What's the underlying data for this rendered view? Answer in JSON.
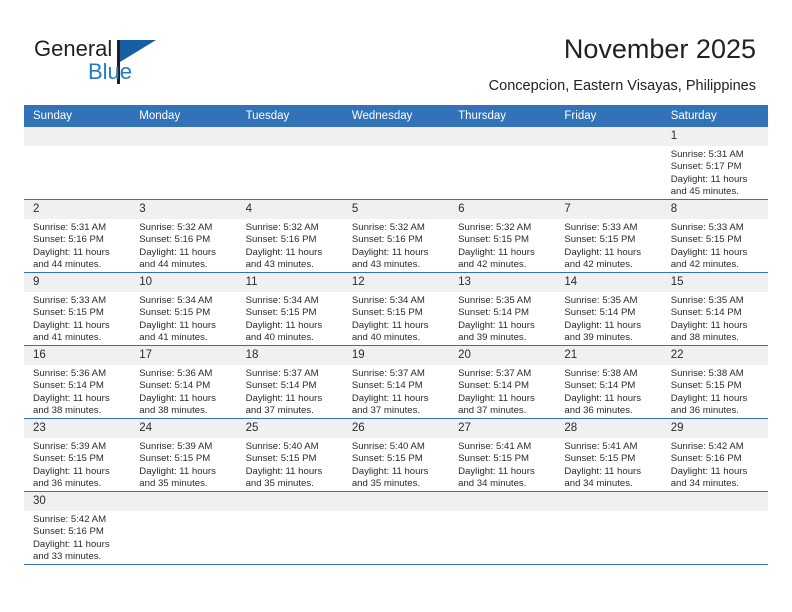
{
  "brand": {
    "name_part1": "General",
    "name_part2": "Blue",
    "logo_icon": "triangle-flag-icon",
    "accent_color": "#1f7ec4",
    "dark_color": "#231f20"
  },
  "header": {
    "title": "November 2025",
    "location": "Concepcion, Eastern Visayas, Philippines"
  },
  "calendar": {
    "header_bg": "#3172b9",
    "daynum_bg": "#f0f0f0",
    "weekdays": [
      "Sunday",
      "Monday",
      "Tuesday",
      "Wednesday",
      "Thursday",
      "Friday",
      "Saturday"
    ],
    "weeks": [
      [
        {
          "blank": true
        },
        {
          "blank": true
        },
        {
          "blank": true
        },
        {
          "blank": true
        },
        {
          "blank": true
        },
        {
          "blank": true
        },
        {
          "day": "1",
          "sunrise": "Sunrise: 5:31 AM",
          "sunset": "Sunset: 5:17 PM",
          "daylight_line1": "Daylight: 11 hours",
          "daylight_line2": "and 45 minutes."
        }
      ],
      [
        {
          "day": "2",
          "sunrise": "Sunrise: 5:31 AM",
          "sunset": "Sunset: 5:16 PM",
          "daylight_line1": "Daylight: 11 hours",
          "daylight_line2": "and 44 minutes."
        },
        {
          "day": "3",
          "sunrise": "Sunrise: 5:32 AM",
          "sunset": "Sunset: 5:16 PM",
          "daylight_line1": "Daylight: 11 hours",
          "daylight_line2": "and 44 minutes."
        },
        {
          "day": "4",
          "sunrise": "Sunrise: 5:32 AM",
          "sunset": "Sunset: 5:16 PM",
          "daylight_line1": "Daylight: 11 hours",
          "daylight_line2": "and 43 minutes."
        },
        {
          "day": "5",
          "sunrise": "Sunrise: 5:32 AM",
          "sunset": "Sunset: 5:16 PM",
          "daylight_line1": "Daylight: 11 hours",
          "daylight_line2": "and 43 minutes."
        },
        {
          "day": "6",
          "sunrise": "Sunrise: 5:32 AM",
          "sunset": "Sunset: 5:15 PM",
          "daylight_line1": "Daylight: 11 hours",
          "daylight_line2": "and 42 minutes."
        },
        {
          "day": "7",
          "sunrise": "Sunrise: 5:33 AM",
          "sunset": "Sunset: 5:15 PM",
          "daylight_line1": "Daylight: 11 hours",
          "daylight_line2": "and 42 minutes."
        },
        {
          "day": "8",
          "sunrise": "Sunrise: 5:33 AM",
          "sunset": "Sunset: 5:15 PM",
          "daylight_line1": "Daylight: 11 hours",
          "daylight_line2": "and 42 minutes."
        }
      ],
      [
        {
          "day": "9",
          "sunrise": "Sunrise: 5:33 AM",
          "sunset": "Sunset: 5:15 PM",
          "daylight_line1": "Daylight: 11 hours",
          "daylight_line2": "and 41 minutes."
        },
        {
          "day": "10",
          "sunrise": "Sunrise: 5:34 AM",
          "sunset": "Sunset: 5:15 PM",
          "daylight_line1": "Daylight: 11 hours",
          "daylight_line2": "and 41 minutes."
        },
        {
          "day": "11",
          "sunrise": "Sunrise: 5:34 AM",
          "sunset": "Sunset: 5:15 PM",
          "daylight_line1": "Daylight: 11 hours",
          "daylight_line2": "and 40 minutes."
        },
        {
          "day": "12",
          "sunrise": "Sunrise: 5:34 AM",
          "sunset": "Sunset: 5:15 PM",
          "daylight_line1": "Daylight: 11 hours",
          "daylight_line2": "and 40 minutes."
        },
        {
          "day": "13",
          "sunrise": "Sunrise: 5:35 AM",
          "sunset": "Sunset: 5:14 PM",
          "daylight_line1": "Daylight: 11 hours",
          "daylight_line2": "and 39 minutes."
        },
        {
          "day": "14",
          "sunrise": "Sunrise: 5:35 AM",
          "sunset": "Sunset: 5:14 PM",
          "daylight_line1": "Daylight: 11 hours",
          "daylight_line2": "and 39 minutes."
        },
        {
          "day": "15",
          "sunrise": "Sunrise: 5:35 AM",
          "sunset": "Sunset: 5:14 PM",
          "daylight_line1": "Daylight: 11 hours",
          "daylight_line2": "and 38 minutes."
        }
      ],
      [
        {
          "day": "16",
          "sunrise": "Sunrise: 5:36 AM",
          "sunset": "Sunset: 5:14 PM",
          "daylight_line1": "Daylight: 11 hours",
          "daylight_line2": "and 38 minutes."
        },
        {
          "day": "17",
          "sunrise": "Sunrise: 5:36 AM",
          "sunset": "Sunset: 5:14 PM",
          "daylight_line1": "Daylight: 11 hours",
          "daylight_line2": "and 38 minutes."
        },
        {
          "day": "18",
          "sunrise": "Sunrise: 5:37 AM",
          "sunset": "Sunset: 5:14 PM",
          "daylight_line1": "Daylight: 11 hours",
          "daylight_line2": "and 37 minutes."
        },
        {
          "day": "19",
          "sunrise": "Sunrise: 5:37 AM",
          "sunset": "Sunset: 5:14 PM",
          "daylight_line1": "Daylight: 11 hours",
          "daylight_line2": "and 37 minutes."
        },
        {
          "day": "20",
          "sunrise": "Sunrise: 5:37 AM",
          "sunset": "Sunset: 5:14 PM",
          "daylight_line1": "Daylight: 11 hours",
          "daylight_line2": "and 37 minutes."
        },
        {
          "day": "21",
          "sunrise": "Sunrise: 5:38 AM",
          "sunset": "Sunset: 5:14 PM",
          "daylight_line1": "Daylight: 11 hours",
          "daylight_line2": "and 36 minutes."
        },
        {
          "day": "22",
          "sunrise": "Sunrise: 5:38 AM",
          "sunset": "Sunset: 5:15 PM",
          "daylight_line1": "Daylight: 11 hours",
          "daylight_line2": "and 36 minutes."
        }
      ],
      [
        {
          "day": "23",
          "sunrise": "Sunrise: 5:39 AM",
          "sunset": "Sunset: 5:15 PM",
          "daylight_line1": "Daylight: 11 hours",
          "daylight_line2": "and 36 minutes."
        },
        {
          "day": "24",
          "sunrise": "Sunrise: 5:39 AM",
          "sunset": "Sunset: 5:15 PM",
          "daylight_line1": "Daylight: 11 hours",
          "daylight_line2": "and 35 minutes."
        },
        {
          "day": "25",
          "sunrise": "Sunrise: 5:40 AM",
          "sunset": "Sunset: 5:15 PM",
          "daylight_line1": "Daylight: 11 hours",
          "daylight_line2": "and 35 minutes."
        },
        {
          "day": "26",
          "sunrise": "Sunrise: 5:40 AM",
          "sunset": "Sunset: 5:15 PM",
          "daylight_line1": "Daylight: 11 hours",
          "daylight_line2": "and 35 minutes."
        },
        {
          "day": "27",
          "sunrise": "Sunrise: 5:41 AM",
          "sunset": "Sunset: 5:15 PM",
          "daylight_line1": "Daylight: 11 hours",
          "daylight_line2": "and 34 minutes."
        },
        {
          "day": "28",
          "sunrise": "Sunrise: 5:41 AM",
          "sunset": "Sunset: 5:15 PM",
          "daylight_line1": "Daylight: 11 hours",
          "daylight_line2": "and 34 minutes."
        },
        {
          "day": "29",
          "sunrise": "Sunrise: 5:42 AM",
          "sunset": "Sunset: 5:16 PM",
          "daylight_line1": "Daylight: 11 hours",
          "daylight_line2": "and 34 minutes."
        }
      ],
      [
        {
          "day": "30",
          "sunrise": "Sunrise: 5:42 AM",
          "sunset": "Sunset: 5:16 PM",
          "daylight_line1": "Daylight: 11 hours",
          "daylight_line2": "and 33 minutes."
        },
        {
          "blank": true
        },
        {
          "blank": true
        },
        {
          "blank": true
        },
        {
          "blank": true
        },
        {
          "blank": true
        },
        {
          "blank": true
        }
      ]
    ]
  }
}
